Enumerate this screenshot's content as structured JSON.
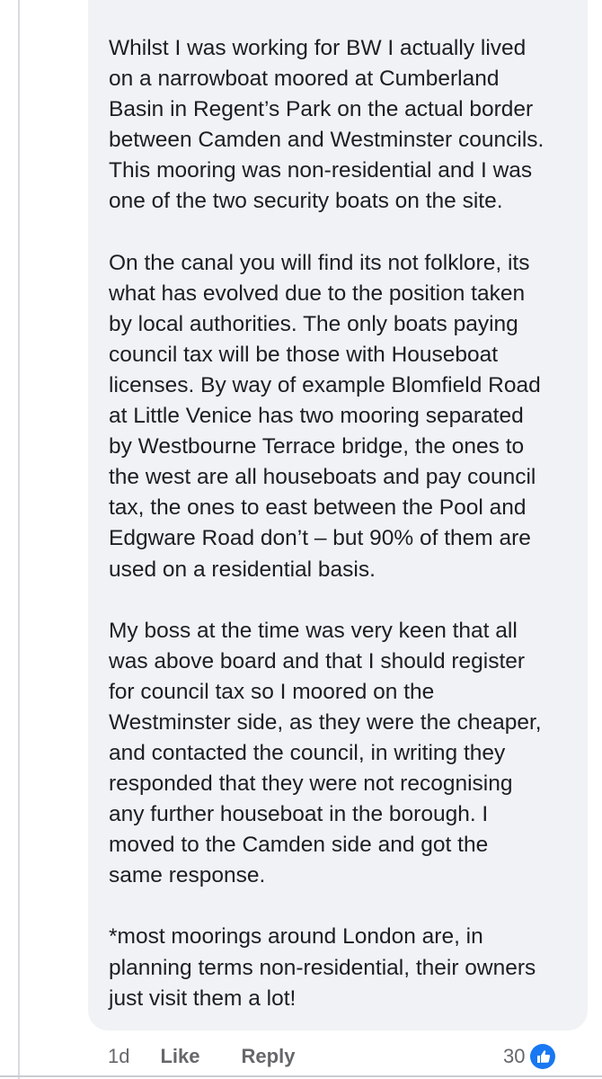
{
  "comment": {
    "author_partial": "· / · · / ·",
    "paragraphs": [
      "Whilst I was working for BW I actually lived\non a narrowboat moored at Cumberland\nBasin in Regent’s Park on the actual border\nbetween Camden and Westminster councils.\nThis mooring was non-residential and I was\none of the two security boats on the site.",
      "On the canal you will find its not folklore, its\nwhat has evolved due to the position taken\nby local authorities. The only boats paying\ncouncil tax will be those with Houseboat\nlicenses. By way of example Blomfield Road\nat Little Venice has two mooring separated\nby Westbourne Terrace bridge, the ones to\nthe west are all houseboats and pay council\ntax, the ones to east between the Pool and\nEdgware Road don’t – but 90% of them are\nused on a residential basis.",
      "My boss at the time was very keen that all\nwas above board and that I should register\nfor council tax so I moored on the\nWestminster side, as they were the cheaper,\nand contacted the council, in writing they\nresponded that they were not recognising\nany further houseboat in the borough. I\nmoved to the Camden side and got the\nsame response.",
      "*most moorings around London are, in\nplanning terms non-residential, their owners\njust visit them a lot!"
    ]
  },
  "actions": {
    "time": "1d",
    "like": "Like",
    "reply": "Reply"
  },
  "reactions": {
    "count": "30",
    "icon": "thumbs-up-icon",
    "color": "#1877f2"
  },
  "colors": {
    "bubble": "#f0f2f5",
    "text": "#1c1e21",
    "muted": "#65676b"
  }
}
